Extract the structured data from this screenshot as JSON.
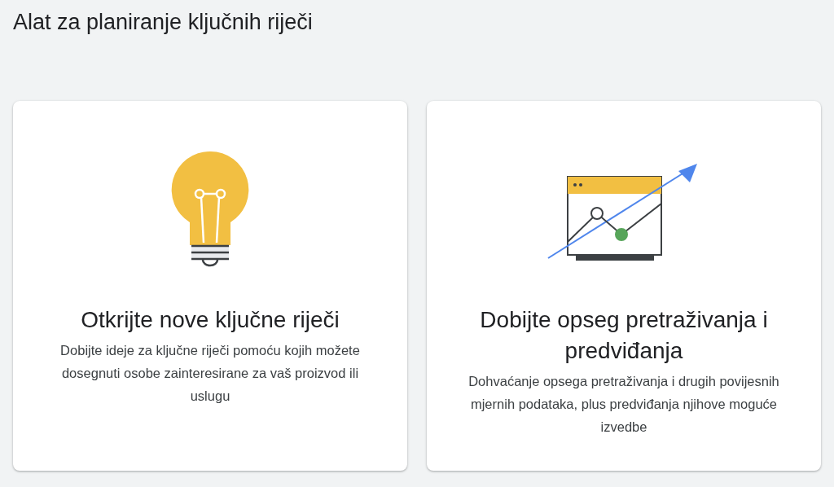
{
  "title": "Alat za planiranje ključnih riječi",
  "cards": [
    {
      "kind": "bulb",
      "title": "Otkrijte nove ključne riječi",
      "description": "Dobijte ideje za ključne riječi pomoću kojih možete dosegnuti osobe zainteresirane za vaš proizvod ili uslugu"
    },
    {
      "kind": "chart",
      "title": "Dobijte opseg pretraživanja i predviđanja",
      "description": "Dohvaćanje opsega pretraživanja i drugih povijesnih mjernih podataka, plus predviđanja njihove moguće izvedbe"
    }
  ]
}
